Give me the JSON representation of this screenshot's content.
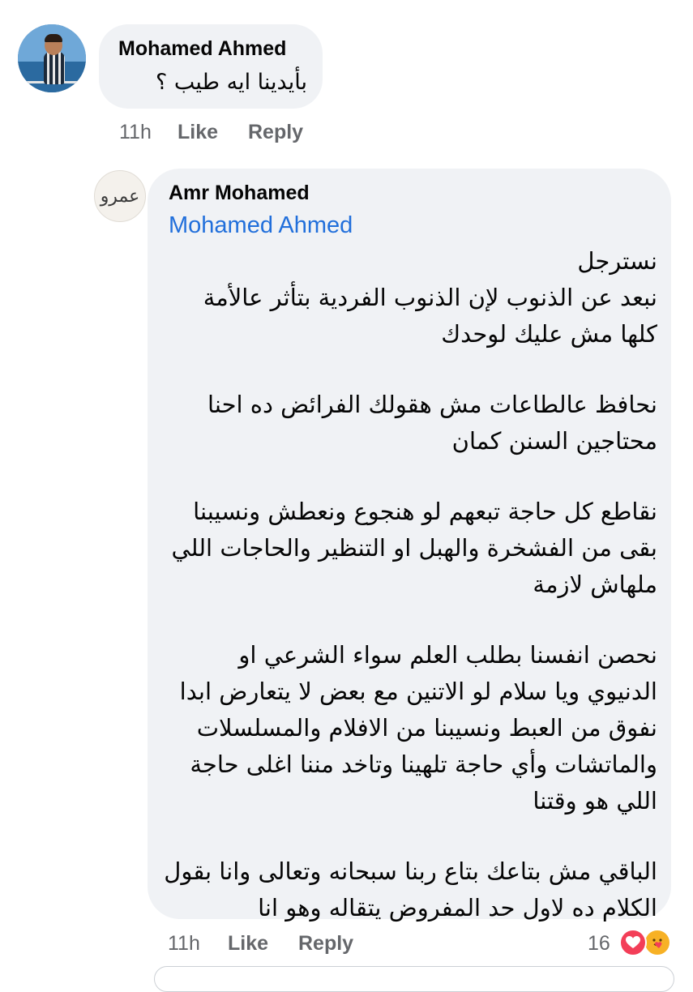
{
  "comment": {
    "author": "Mohamed Ahmed",
    "text": "بأيدينا ايه طيب ؟",
    "time": "11h",
    "like_label": "Like",
    "reply_label": "Reply"
  },
  "reply": {
    "author": "Amr Mohamed",
    "avatar_text": "عمرو",
    "mention": "Mohamed Ahmed",
    "lines": [
      "نسترجل",
      "نبعد عن الذنوب لإن الذنوب الفردية بتأثر عالأمة",
      "كلها مش عليك لوحدك",
      "",
      "نحافظ عالطاعات مش هقولك الفرائض ده احنا",
      "محتاجين السنن كمان",
      "",
      "نقاطع كل حاجة تبعهم لو هنجوع ونعطش ونسيبنا",
      "بقى من الفشخرة والهبل او التنظير والحاجات اللي",
      "ملهاش لازمة",
      "",
      "نحصن انفسنا بطلب العلم سواء الشرعي او",
      "الدنيوي ويا سلام لو الاتنين مع بعض لا يتعارض ابدا",
      "نفوق من العبط ونسيبنا من الافلام والمسلسلات",
      "والماتشات وأي حاجة تلهينا وتاخد مننا اغلى حاجة",
      "اللي هو وقتنا",
      "",
      "الباقي مش بتاعك بتاع ربنا سبحانه وتعالى وانا بقول",
      "الكلام ده لاول حد المفروض يتقاله وهو انا"
    ],
    "time": "11h",
    "like_label": "Like",
    "reply_label": "Reply",
    "reaction_count": "16",
    "reactions": [
      "heart-icon",
      "care-icon"
    ]
  },
  "colors": {
    "bubble": "#f0f2f5",
    "mention": "#216fdb",
    "meta": "#65676b",
    "heart": "#f33e58",
    "care": "#f7b125"
  }
}
